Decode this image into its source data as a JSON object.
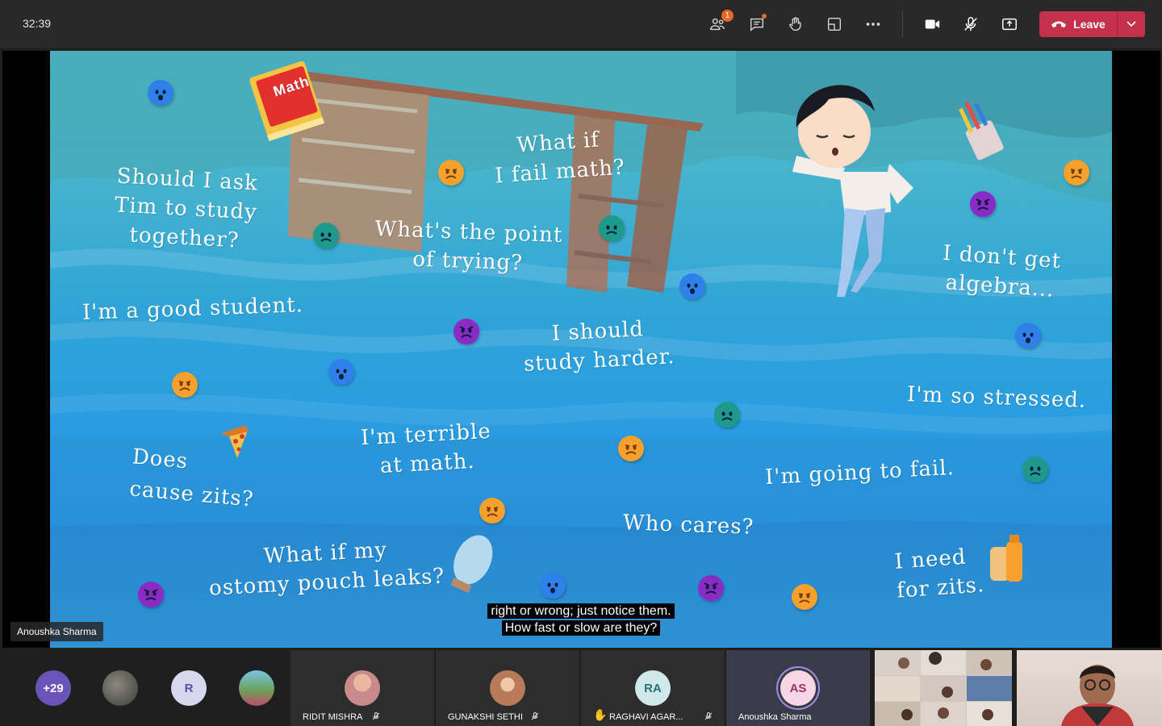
{
  "meeting": {
    "timer": "32:39",
    "participants_badge": "1",
    "leave_label": "Leave"
  },
  "toolbar_icons": [
    "people-icon",
    "chat-icon",
    "raise-hand-icon",
    "rooms-icon",
    "more-icon",
    "camera-icon",
    "mic-off-icon",
    "share-icon"
  ],
  "slide": {
    "book_label": "Math",
    "thoughts": [
      "Should I ask\nTim to study\ntogether?",
      "What if\nI fail math?",
      "What's the point\nof trying?",
      "I'm a good student.",
      "I should\nstudy harder.",
      "I don't get\nalgebra...",
      "I'm so stressed.",
      "Does\ncause zits?",
      "I'm terrible\nat math.",
      "I'm going to fail.",
      "Who cares?",
      "What if my\nostomy pouch leaks?",
      "I need\nfor zits."
    ],
    "captions": [
      "right or wrong; just notice them.",
      "How fast or slow are they?"
    ],
    "presenter_name": "Anoushka Sharma"
  },
  "colors": {
    "topbar": "#292929",
    "leave": "#c4314b",
    "emoji_orange": "#f6a12d",
    "emoji_blue": "#2f80e8",
    "emoji_purple": "#8a2bc6",
    "emoji_teal": "#1e9a8c"
  },
  "gallery": {
    "overflow_count": "+29",
    "avatar_r": "R",
    "tiles": [
      {
        "name": "RIDIT MISHRA",
        "initials": ""
      },
      {
        "name": "GUNAKSHI SETHI",
        "initials": ""
      },
      {
        "name": "RAGHAVI AGAR...",
        "initials": "RA"
      },
      {
        "name": "Anoushka Sharma",
        "initials": "AS"
      }
    ]
  }
}
